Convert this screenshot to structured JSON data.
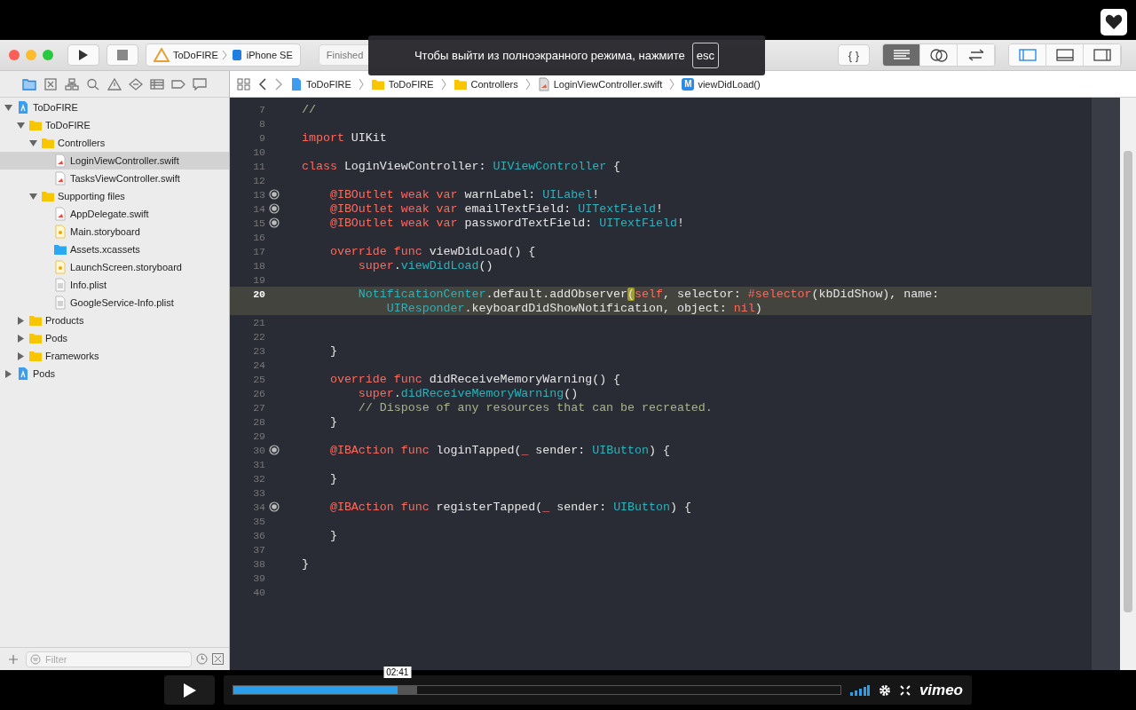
{
  "toolbar": {
    "scheme": {
      "target": "ToDoFIRE",
      "device": "iPhone SE"
    },
    "activity": "Finished",
    "library_button": "{ }",
    "editor_modes": [
      {
        "kind": "standard",
        "selected": true
      },
      {
        "kind": "assistant",
        "selected": false
      },
      {
        "kind": "version",
        "selected": false
      }
    ],
    "panels": [
      {
        "kind": "navigator",
        "selected": true
      },
      {
        "kind": "debug",
        "selected": false
      },
      {
        "kind": "utilities",
        "selected": false
      }
    ]
  },
  "overlay": {
    "message": "Чтобы выйти из полноэкранного режима, нажмите",
    "key": "esc"
  },
  "navigator_tabs": [
    {
      "kind": "folder",
      "selected": true
    },
    {
      "kind": "source",
      "selected": false
    },
    {
      "kind": "symbols",
      "selected": false
    },
    {
      "kind": "find",
      "selected": false
    },
    {
      "kind": "issues",
      "selected": false
    },
    {
      "kind": "tests",
      "selected": false
    },
    {
      "kind": "debug",
      "selected": false
    },
    {
      "kind": "breakpoints",
      "selected": false
    },
    {
      "kind": "reports",
      "selected": false
    }
  ],
  "sidebar": {
    "tree": [
      {
        "label": "ToDoFIRE",
        "kind": "project",
        "expanded": true,
        "selected": false,
        "children": [
          {
            "label": "ToDoFIRE",
            "kind": "folder",
            "expanded": true,
            "selected": false,
            "children": [
              {
                "label": "Controllers",
                "kind": "folder",
                "expanded": true,
                "selected": false,
                "children": [
                  {
                    "label": "LoginViewController.swift",
                    "kind": "swift",
                    "selected": true
                  },
                  {
                    "label": "TasksViewController.swift",
                    "kind": "swift",
                    "selected": false
                  }
                ]
              },
              {
                "label": "Supporting files",
                "kind": "folder",
                "expanded": true,
                "selected": false,
                "children": [
                  {
                    "label": "AppDelegate.swift",
                    "kind": "swift",
                    "selected": false
                  },
                  {
                    "label": "Main.storyboard",
                    "kind": "storyboard",
                    "selected": false
                  },
                  {
                    "label": "Assets.xcassets",
                    "kind": "assets",
                    "selected": false
                  },
                  {
                    "label": "LaunchScreen.storyboard",
                    "kind": "storyboard",
                    "selected": false
                  },
                  {
                    "label": "Info.plist",
                    "kind": "plist",
                    "selected": false
                  },
                  {
                    "label": "GoogleService-Info.plist",
                    "kind": "plist",
                    "selected": false
                  }
                ]
              }
            ]
          },
          {
            "label": "Products",
            "kind": "folder",
            "expanded": false,
            "selected": false
          },
          {
            "label": "Pods",
            "kind": "folder",
            "expanded": false,
            "selected": false
          },
          {
            "label": "Frameworks",
            "kind": "folder",
            "expanded": false,
            "selected": false
          }
        ]
      },
      {
        "label": "Pods",
        "kind": "project",
        "expanded": false,
        "selected": false
      }
    ],
    "filter": {
      "placeholder": "Filter"
    }
  },
  "jump_bar": [
    {
      "kind": "project",
      "label": "ToDoFIRE"
    },
    {
      "kind": "folder",
      "label": "ToDoFIRE"
    },
    {
      "kind": "folder",
      "label": "Controllers"
    },
    {
      "kind": "swift",
      "label": "LoginViewController.swift"
    },
    {
      "kind": "method",
      "badge": "M",
      "label": "viewDidLoad()"
    }
  ],
  "code": [
    {
      "number": "7",
      "tokens": [
        {
          "kind": "comment",
          "text": "//"
        }
      ]
    },
    {
      "number": "8"
    },
    {
      "number": "9",
      "tokens": [
        {
          "kind": "keyword",
          "text": "import"
        },
        {
          "kind": "plain",
          "text": " UIKit"
        }
      ]
    },
    {
      "number": "10"
    },
    {
      "number": "11",
      "tokens": [
        {
          "kind": "keyword",
          "text": "class"
        },
        {
          "kind": "plain",
          "text": " LoginViewController: "
        },
        {
          "kind": "type",
          "text": "UIViewController"
        },
        {
          "kind": "plain",
          "text": " {"
        }
      ]
    },
    {
      "number": "12"
    },
    {
      "number": "13",
      "connected": true,
      "tokens": [
        {
          "kind": "keyword",
          "text": "    @IBOutlet weak var"
        },
        {
          "kind": "plain",
          "text": " warnLabel: "
        },
        {
          "kind": "type",
          "text": "UILabel"
        },
        {
          "kind": "plain",
          "text": "!"
        }
      ]
    },
    {
      "number": "14",
      "connected": true,
      "tokens": [
        {
          "kind": "keyword",
          "text": "    @IBOutlet weak var"
        },
        {
          "kind": "plain",
          "text": " emailTextField: "
        },
        {
          "kind": "type",
          "text": "UITextField"
        },
        {
          "kind": "plain",
          "text": "!"
        }
      ]
    },
    {
      "number": "15",
      "connected": true,
      "tokens": [
        {
          "kind": "keyword",
          "text": "    @IBOutlet weak var"
        },
        {
          "kind": "plain",
          "text": " passwordTextField: "
        },
        {
          "kind": "type",
          "text": "UITextField"
        },
        {
          "kind": "plain",
          "text": "!"
        }
      ]
    },
    {
      "number": "16"
    },
    {
      "number": "17",
      "tokens": [
        {
          "kind": "keyword",
          "text": "    override func"
        },
        {
          "kind": "plain",
          "text": " viewDidLoad() {"
        }
      ]
    },
    {
      "number": "18",
      "tokens": [
        {
          "kind": "keyword",
          "text": "        super"
        },
        {
          "kind": "plain",
          "text": "."
        },
        {
          "kind": "type",
          "text": "viewDidLoad"
        },
        {
          "kind": "plain",
          "text": "()"
        }
      ]
    },
    {
      "number": "19"
    },
    {
      "number": "20",
      "current": true,
      "tokens": [
        {
          "kind": "type",
          "text": "        NotificationCenter"
        },
        {
          "kind": "plain",
          "text": ".default.addObserver"
        },
        {
          "kind": "match",
          "text": "("
        },
        {
          "kind": "keyword",
          "text": "self"
        },
        {
          "kind": "plain",
          "text": ", selector: "
        },
        {
          "kind": "keyword",
          "text": "#selector"
        },
        {
          "kind": "plain",
          "text": "(kbDidShow), name:"
        }
      ],
      "continuation": [
        {
          "kind": "type",
          "text": "            UIResponder"
        },
        {
          "kind": "plain",
          "text": ".keyboardDidShowNotification, object: "
        },
        {
          "kind": "keyword",
          "text": "nil"
        },
        {
          "kind": "plain",
          "text": ")"
        }
      ]
    },
    {
      "number": "21"
    },
    {
      "number": "22"
    },
    {
      "number": "23",
      "tokens": [
        {
          "kind": "plain",
          "text": "    }"
        }
      ]
    },
    {
      "number": "24"
    },
    {
      "number": "25",
      "tokens": [
        {
          "kind": "keyword",
          "text": "    override func"
        },
        {
          "kind": "plain",
          "text": " didReceiveMemoryWarning() {"
        }
      ]
    },
    {
      "number": "26",
      "tokens": [
        {
          "kind": "keyword",
          "text": "        super"
        },
        {
          "kind": "plain",
          "text": "."
        },
        {
          "kind": "type",
          "text": "didReceiveMemoryWarning"
        },
        {
          "kind": "plain",
          "text": "()"
        }
      ]
    },
    {
      "number": "27",
      "tokens": [
        {
          "kind": "comment",
          "text": "        // Dispose of any resources that can be recreated."
        }
      ]
    },
    {
      "number": "28",
      "tokens": [
        {
          "kind": "plain",
          "text": "    }"
        }
      ]
    },
    {
      "number": "29"
    },
    {
      "number": "30",
      "connected": true,
      "tokens": [
        {
          "kind": "keyword",
          "text": "    @IBAction func"
        },
        {
          "kind": "plain",
          "text": " loginTapped("
        },
        {
          "kind": "keyword",
          "text": "_"
        },
        {
          "kind": "plain",
          "text": " sender: "
        },
        {
          "kind": "type",
          "text": "UIButton"
        },
        {
          "kind": "plain",
          "text": ") {"
        }
      ]
    },
    {
      "number": "31"
    },
    {
      "number": "32",
      "tokens": [
        {
          "kind": "plain",
          "text": "    }"
        }
      ]
    },
    {
      "number": "33"
    },
    {
      "number": "34",
      "connected": true,
      "tokens": [
        {
          "kind": "keyword",
          "text": "    @IBAction func"
        },
        {
          "kind": "plain",
          "text": " registerTapped("
        },
        {
          "kind": "keyword",
          "text": "_"
        },
        {
          "kind": "plain",
          "text": " sender: "
        },
        {
          "kind": "type",
          "text": "UIButton"
        },
        {
          "kind": "plain",
          "text": ") {"
        }
      ]
    },
    {
      "number": "35"
    },
    {
      "number": "36",
      "tokens": [
        {
          "kind": "plain",
          "text": "    }"
        }
      ]
    },
    {
      "number": "37"
    },
    {
      "number": "38",
      "tokens": [
        {
          "kind": "plain",
          "text": "}"
        }
      ]
    },
    {
      "number": "39"
    },
    {
      "number": "40"
    }
  ],
  "player": {
    "progress": {
      "level": 0.27
    },
    "time": "02:41",
    "logo": "vimeo"
  }
}
